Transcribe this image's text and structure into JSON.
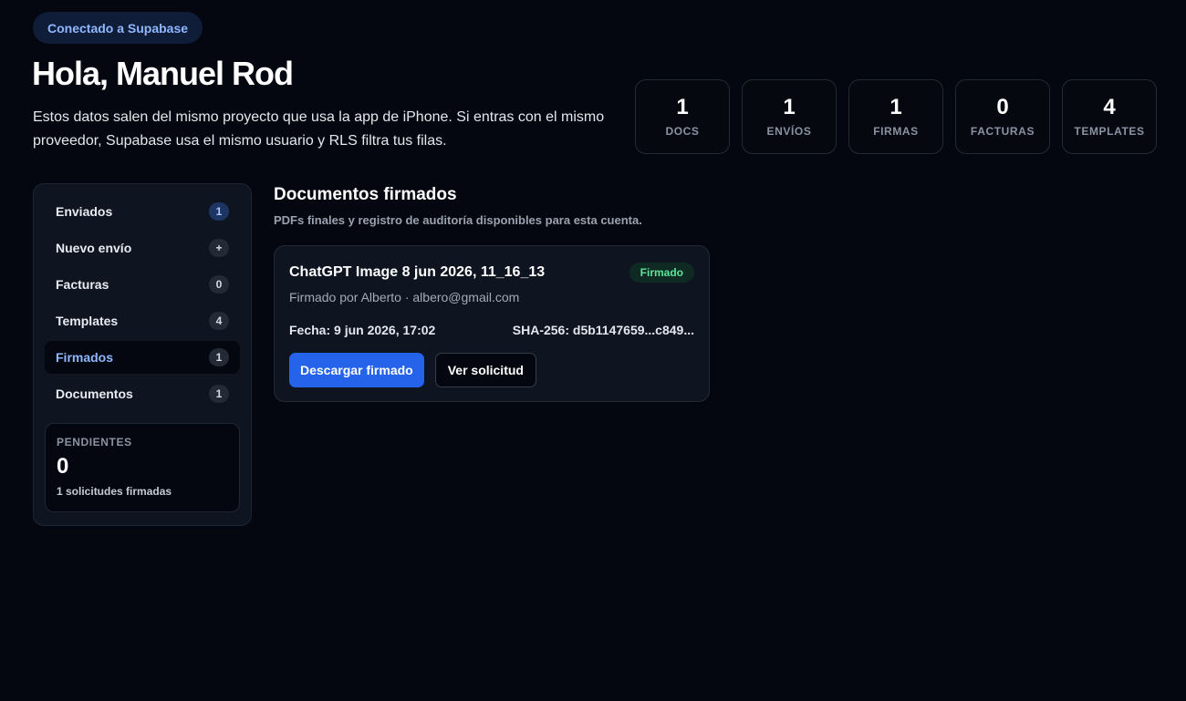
{
  "header": {
    "status_pill": "Conectado a Supabase",
    "greeting": "Hola, Manuel Rod",
    "intro": "Estos datos salen del mismo proyecto que usa la app de iPhone. Si entras con el mismo proveedor, Supabase usa el mismo usuario y RLS filtra tus filas."
  },
  "stats": [
    {
      "value": "1",
      "label": "DOCS"
    },
    {
      "value": "1",
      "label": "ENVÍOS"
    },
    {
      "value": "1",
      "label": "FIRMAS"
    },
    {
      "value": "0",
      "label": "FACTURAS"
    },
    {
      "value": "4",
      "label": "TEMPLATES"
    }
  ],
  "sidebar": {
    "items": [
      {
        "label": "Enviados",
        "badge": "1"
      },
      {
        "label": "Nuevo envío",
        "badge": "+"
      },
      {
        "label": "Facturas",
        "badge": "0"
      },
      {
        "label": "Templates",
        "badge": "4"
      },
      {
        "label": "Firmados",
        "badge": "1"
      },
      {
        "label": "Documentos",
        "badge": "1"
      }
    ],
    "pending": {
      "label": "PENDIENTES",
      "value": "0",
      "sub": "1 solicitudes firmadas"
    }
  },
  "main": {
    "title": "Documentos firmados",
    "subtitle": "PDFs finales y registro de auditoría disponibles para esta cuenta.",
    "document": {
      "title": "ChatGPT Image 8 jun 2026, 11_16_13",
      "status": "Firmado",
      "signer": "Firmado por Alberto · albero@gmail.com",
      "date": "Fecha: 9 jun 2026, 17:02",
      "hash": "SHA-256: d5b1147659...c849...",
      "download_label": "Descargar firmado",
      "view_label": "Ver solicitud"
    }
  },
  "colors": {
    "background": "#04070f",
    "accent": "#2563eb",
    "active_nav": "#8fb7ff",
    "status_green": "#5ee39a"
  }
}
